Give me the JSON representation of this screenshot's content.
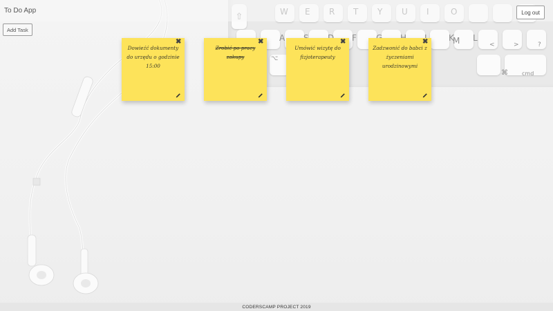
{
  "header": {
    "app_title": "To Do App",
    "logout_label": "Log out"
  },
  "toolbar": {
    "add_task_label": "Add Task"
  },
  "notes": [
    {
      "text": "Dowieźć dokumenty do urzędu o godzinie 15:00",
      "completed": false
    },
    {
      "text": "Zrobić po pracy zakupy",
      "completed": true
    },
    {
      "text": "Umówić wizytę do fizjoterapeuty",
      "completed": false
    },
    {
      "text": "Zadzwonić do babci z życzeniami urodzinowymi",
      "completed": false
    }
  ],
  "note_color": "#fde35a",
  "keyboard_keys": [
    "A",
    "S",
    "D",
    "F",
    "G",
    "H",
    "J",
    "K",
    "L",
    "W",
    "E",
    "R",
    "T",
    "Y",
    "U",
    "I",
    "O",
    "M",
    "<",
    ">",
    "?",
    "cmd",
    "⌘",
    "⌥"
  ],
  "footer": {
    "text": "CODERSCAMP PROJECT 2019"
  }
}
